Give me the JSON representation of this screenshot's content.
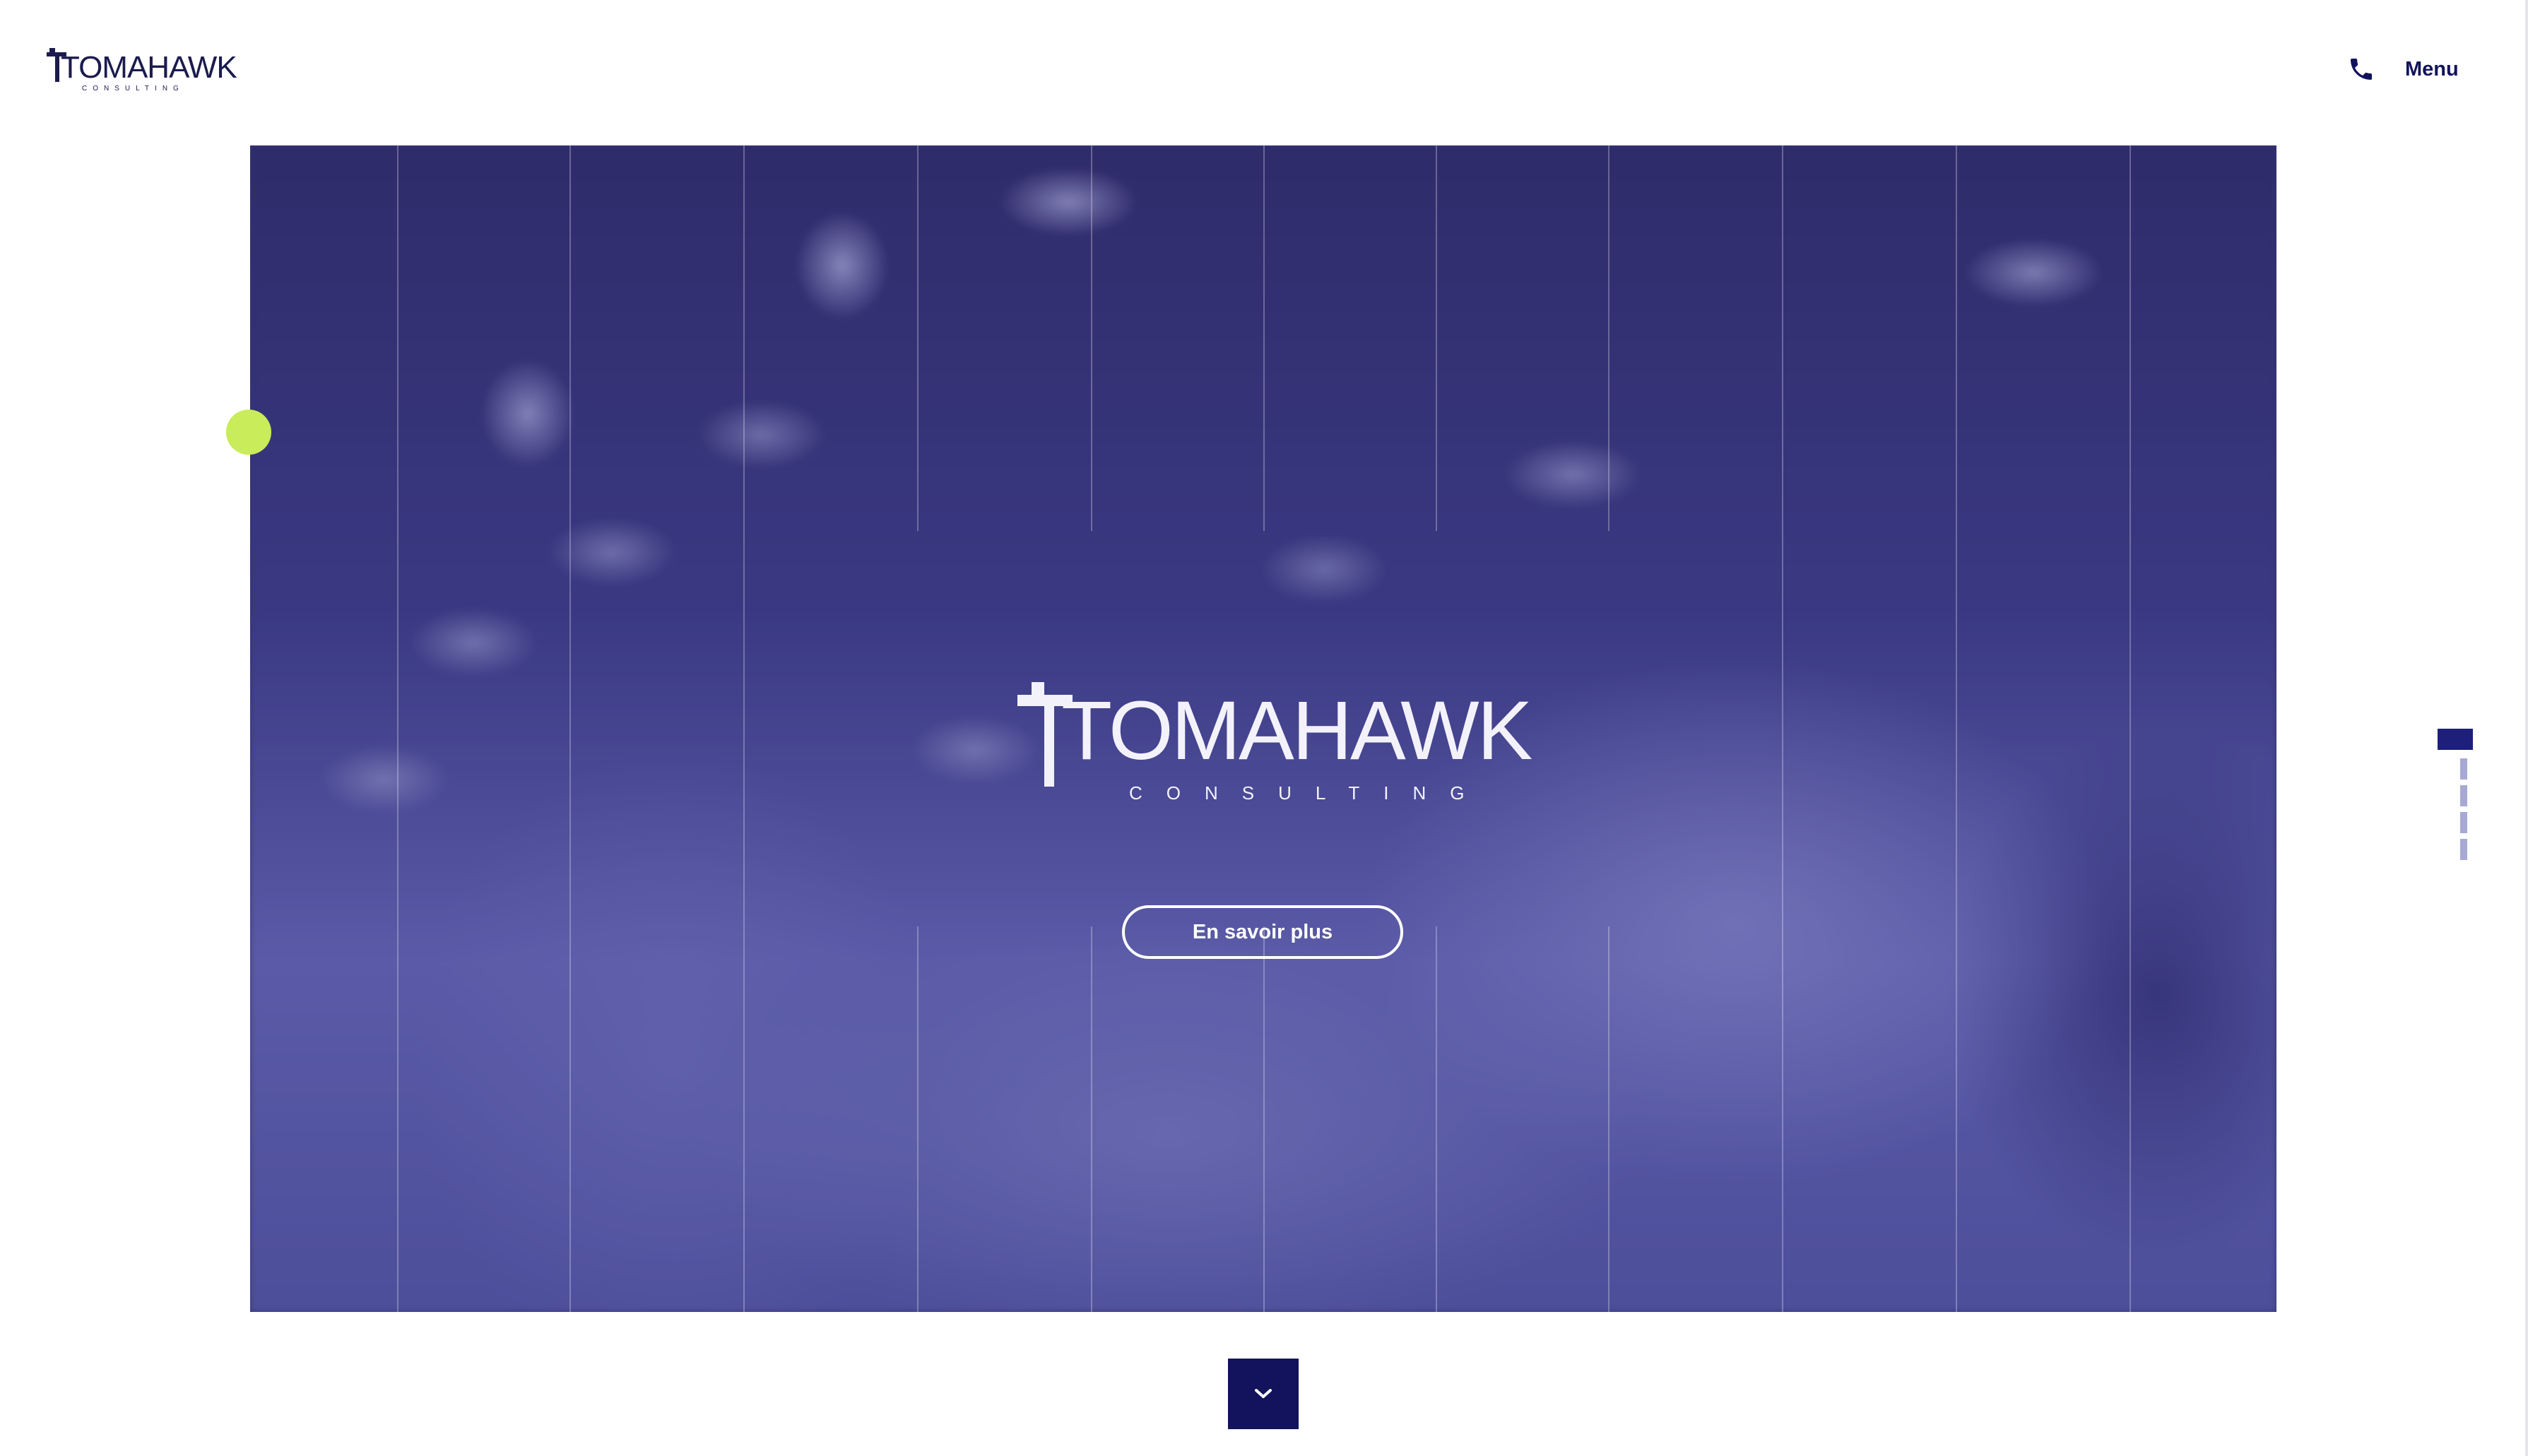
{
  "header": {
    "logo_text": "TOMAHAWK",
    "logo_subtext": "CONSULTING",
    "phone_icon": "phone-icon",
    "menu_label": "Menu"
  },
  "hero": {
    "logo_text": "TOMAHAWK",
    "logo_subtext": "CONSULTING",
    "cta_label": "En savoir plus"
  },
  "slider": {
    "slide_count": 5,
    "active_index": 0
  },
  "scroll_down": {
    "icon": "chevron-down-icon"
  },
  "colors": {
    "brand_navy": "#12135c",
    "hero_overlay": "#3a3878",
    "cursor_accent": "#c8ec5a",
    "indicator_inactive": "#a7a9d4"
  }
}
